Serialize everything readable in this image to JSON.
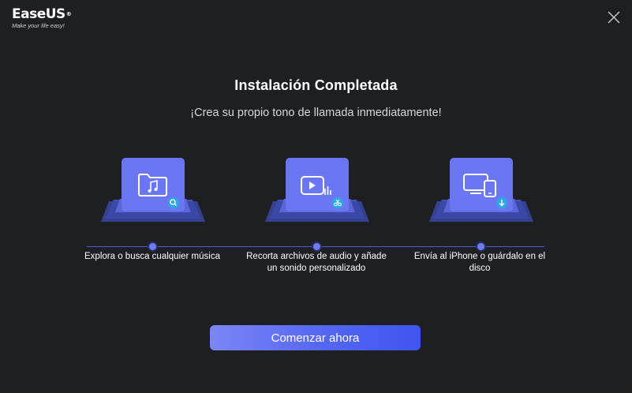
{
  "brand": {
    "name": "EaseUS",
    "registered": "®",
    "tagline": "Make your life easy!"
  },
  "window": {
    "close_icon": "close-icon"
  },
  "header": {
    "title": "Instalación Completada",
    "subtitle": "¡Crea su propio tono de llamada inmediatamente!"
  },
  "features": [
    {
      "icon": "music-folder-icon",
      "badge_icon": "search-badge-icon",
      "label": "Explora o busca cualquier música"
    },
    {
      "icon": "video-audio-icon",
      "badge_icon": "scissors-badge-icon",
      "label": "Recorta archivos de audio y añade un sonido personalizado"
    },
    {
      "icon": "devices-icon",
      "badge_icon": "download-badge-icon",
      "label": "Envía al iPhone o guárdalo en el disco"
    }
  ],
  "cta": {
    "label": "Comenzar ahora"
  },
  "colors": {
    "background": "#1e1f23",
    "accent": "#5366f3",
    "tile": "#6b77f2",
    "line": "#4a5bd9"
  }
}
